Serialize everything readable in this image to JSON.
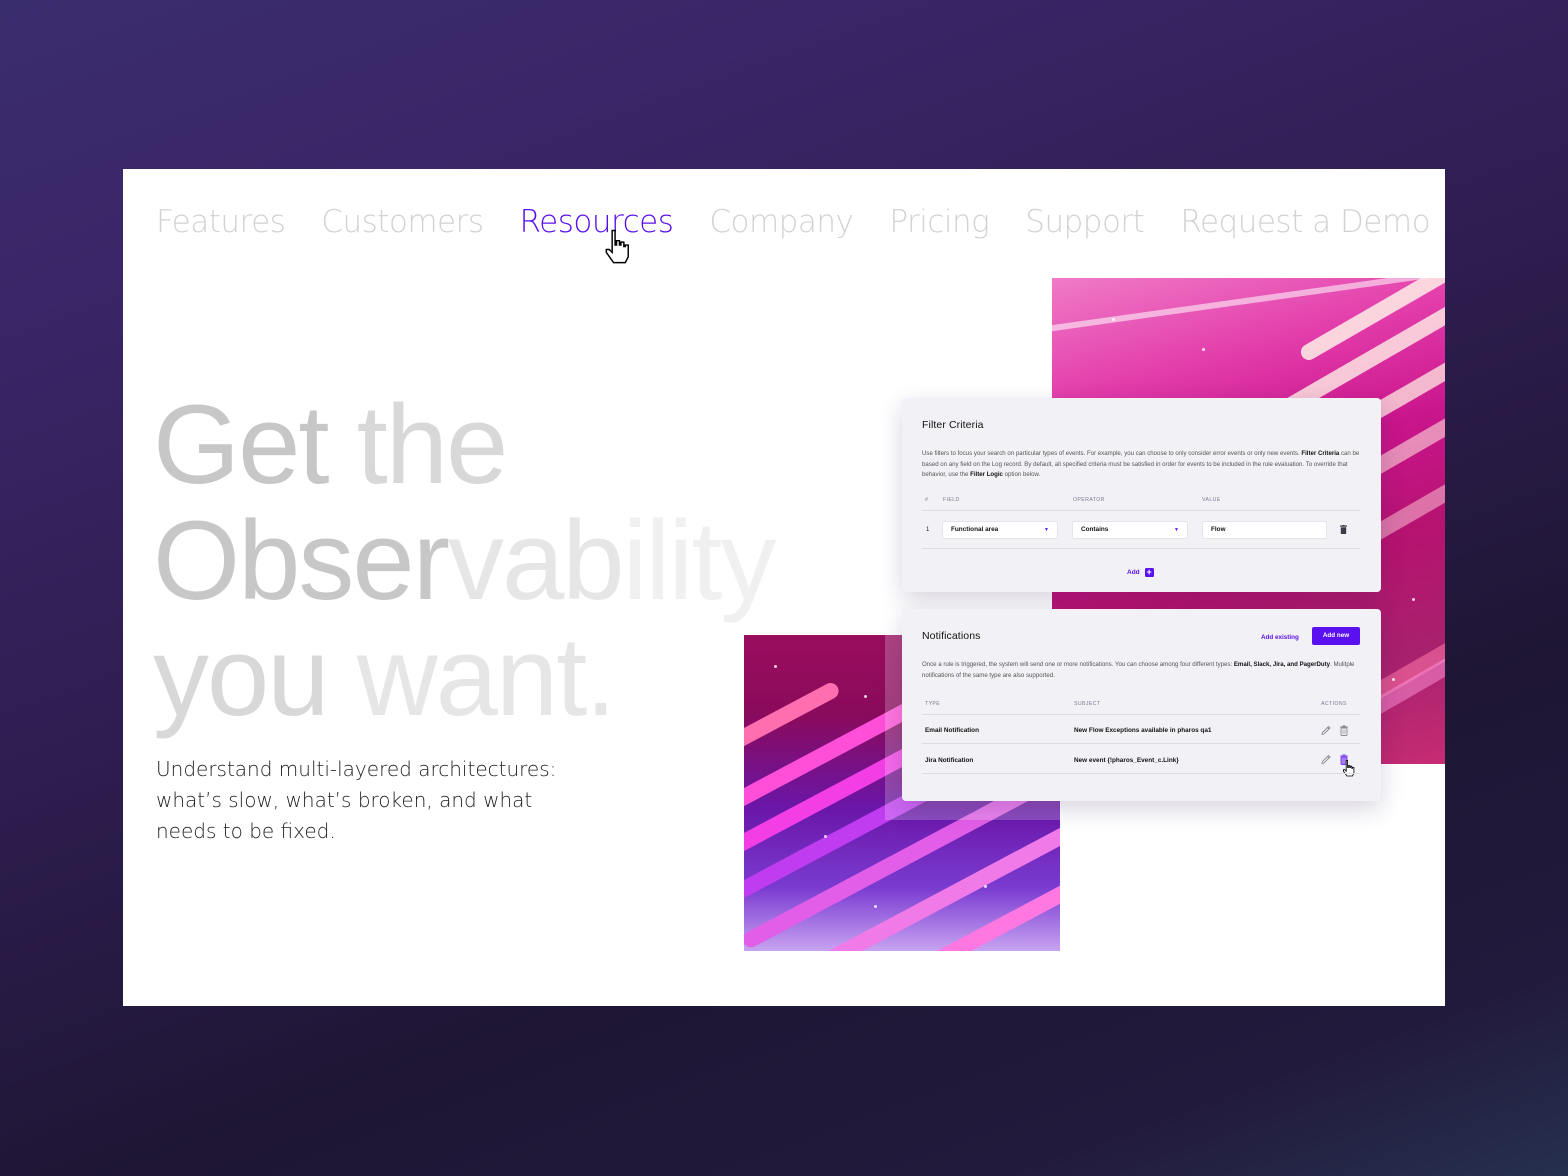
{
  "nav": {
    "items": [
      {
        "label": "Features",
        "active": false
      },
      {
        "label": "Customers",
        "active": false
      },
      {
        "label": "Resources",
        "active": true
      },
      {
        "label": "Company",
        "active": false
      },
      {
        "label": "Pricing",
        "active": false
      },
      {
        "label": "Support",
        "active": false
      },
      {
        "label": "Request a Demo",
        "active": false
      }
    ]
  },
  "hero": {
    "line1a": "Get ",
    "line1b": "the",
    "line2a": "Obser",
    "line2b": "vab",
    "line2c": "ility",
    "line3a": "you ",
    "line3b": "want.",
    "subtitle": "Understand multi-layered architectures: what’s slow, what’s broken, and what needs to be fixed."
  },
  "filter_card": {
    "title": "Filter Criteria",
    "desc_part1": "Use filters to focus your search on particular types of events. For example, you can choose to only consider error events or only new events. ",
    "desc_bold1": "Filter Criteria",
    "desc_part2": " can be based on any field on the Log record. By default, all specified criteria must be satisfied in order for events to be included in the rule evaluation. To override that behavior, use the ",
    "desc_bold2": "Filter Logic",
    "desc_part3": " option below.",
    "columns": {
      "num": "#",
      "field": "Field",
      "operator": "Operator",
      "value": "Value"
    },
    "rows": [
      {
        "num": "1",
        "field": "Functional area",
        "operator": "Contains",
        "value": "Flow"
      }
    ],
    "add_label": "Add",
    "add_icon": "+"
  },
  "notifications_card": {
    "title": "Notifications",
    "add_existing_label": "Add existing",
    "add_new_label": "Add new",
    "desc_part1": "Once a rule is triggered, the system will send one or more notifications. You can choose among four different types: ",
    "desc_bold": "Email, Slack, Jira, and PagerDuty",
    "desc_part2": ". Mulitple notifications of the same type are also supported.",
    "columns": {
      "type": "Type",
      "subject": "Subject",
      "actions": "Actions"
    },
    "rows": [
      {
        "type": "Email Notification",
        "subject": "New Flow Exceptions available in pharos qa1"
      },
      {
        "type": "Jira Notification",
        "subject": "New event {!pharos_Event_c.Link}"
      }
    ]
  },
  "colors": {
    "accent": "#5a10f0",
    "nav_inactive": "#d2d2d2",
    "card_bg": "#f2f2f6"
  }
}
